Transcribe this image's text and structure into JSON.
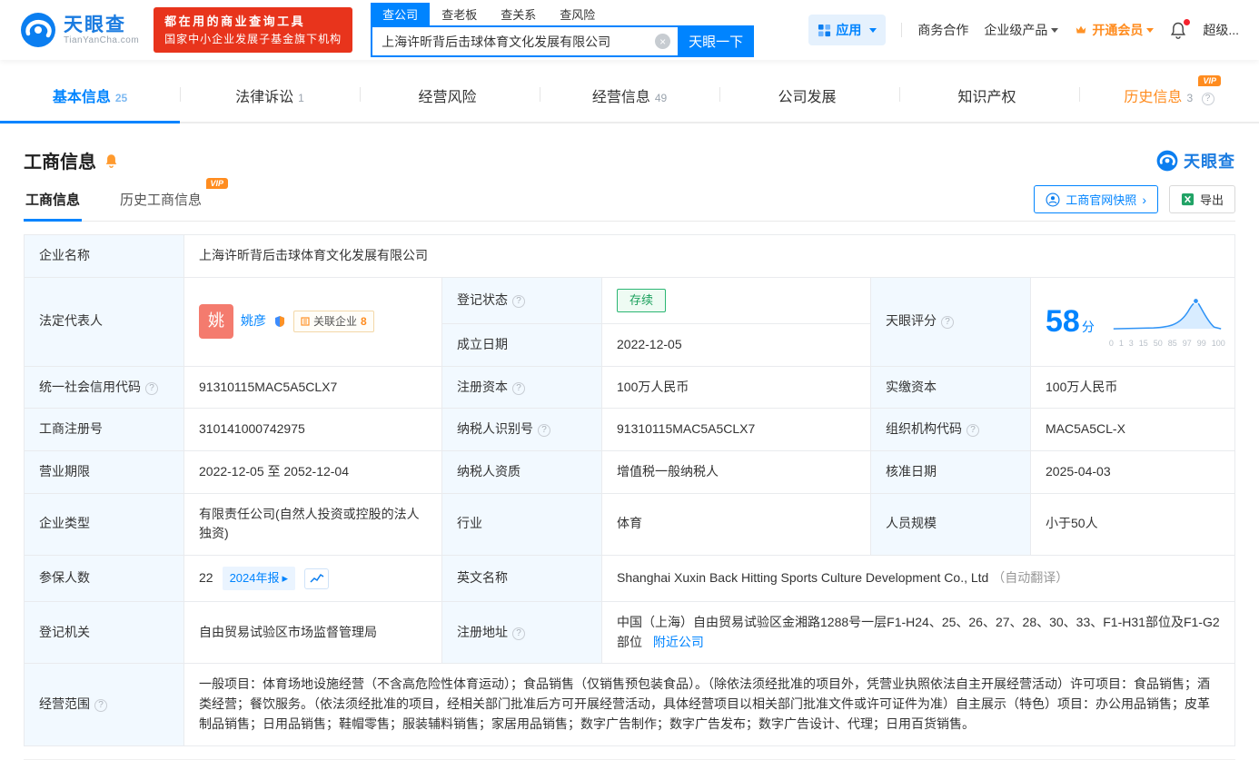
{
  "icons": {
    "close": "×",
    "question": "?",
    "chevron": "›",
    "caret_right": "▸"
  },
  "header": {
    "logo": {
      "name": "天眼查",
      "domain": "TianYanCha.com"
    },
    "promo": {
      "line1": "都在用的商业查询工具",
      "line2": "国家中小企业发展子基金旗下机构"
    },
    "search": {
      "tabs": [
        {
          "label": "查公司"
        },
        {
          "label": "查老板"
        },
        {
          "label": "查关系"
        },
        {
          "label": "查风险"
        }
      ],
      "value": "上海许昕背后击球体育文化发展有限公司",
      "submit": "天眼一下"
    },
    "nav": {
      "apps": "应用",
      "cooperation": "商务合作",
      "enterprise": "企业级产品",
      "membership": "开通会员",
      "super": "超级..."
    }
  },
  "tabs": [
    {
      "label": "基本信息",
      "count": "25"
    },
    {
      "label": "法律诉讼",
      "count": "1"
    },
    {
      "label": "经营风险",
      "count": ""
    },
    {
      "label": "经营信息",
      "count": "49"
    },
    {
      "label": "公司发展",
      "count": ""
    },
    {
      "label": "知识产权",
      "count": ""
    },
    {
      "label": "历史信息",
      "count": "3",
      "vip": "VIP"
    }
  ],
  "section": {
    "title": "工商信息",
    "brand": "天眼查",
    "subtabs": [
      {
        "label": "工商信息"
      },
      {
        "label": "历史工商信息",
        "vip": "VIP"
      }
    ],
    "snapshot": "工商官网快照",
    "export": "导出"
  },
  "fields": {
    "name": {
      "label": "企业名称",
      "value": "上海许昕背后击球体育文化发展有限公司"
    },
    "legal": {
      "label": "法定代表人",
      "avatar": "姚",
      "person": "姚彦",
      "related": "关联企业",
      "related_count": "8"
    },
    "status": {
      "label": "登记状态",
      "value": "存续"
    },
    "score": {
      "label": "天眼评分",
      "value": "58",
      "unit": "分",
      "axis": [
        "0",
        "1",
        "3",
        "15",
        "50",
        "85",
        "97",
        "99",
        "100"
      ]
    },
    "established": {
      "label": "成立日期",
      "value": "2022-12-05"
    },
    "credit_code": {
      "label": "统一社会信用代码",
      "value": "91310115MAC5A5CLX7"
    },
    "reg_capital": {
      "label": "注册资本",
      "value": "100万人民币"
    },
    "paid_capital": {
      "label": "实缴资本",
      "value": "100万人民币"
    },
    "reg_number": {
      "label": "工商注册号",
      "value": "310141000742975"
    },
    "taxpayer_id": {
      "label": "纳税人识别号",
      "value": "91310115MAC5A5CLX7"
    },
    "org_code": {
      "label": "组织机构代码",
      "value": "MAC5A5CL-X"
    },
    "term": {
      "label": "营业期限",
      "value": "2022-12-05 至 2052-12-04"
    },
    "taxpayer_quality": {
      "label": "纳税人资质",
      "value": "增值税一般纳税人"
    },
    "approval_date": {
      "label": "核准日期",
      "value": "2025-04-03"
    },
    "company_type": {
      "label": "企业类型",
      "value": "有限责任公司(自然人投资或控股的法人独资)"
    },
    "industry": {
      "label": "行业",
      "value": "体育"
    },
    "staff_size": {
      "label": "人员规模",
      "value": "小于50人"
    },
    "insured": {
      "label": "参保人数",
      "value": "22",
      "report": "2024年报"
    },
    "english_name": {
      "label": "英文名称",
      "value": "Shanghai Xuxin Back Hitting Sports Culture Development Co., Ltd",
      "note": "（自动翻译）"
    },
    "reg_authority": {
      "label": "登记机关",
      "value": "自由贸易试验区市场监督管理局"
    },
    "address": {
      "label": "注册地址",
      "value": "中国（上海）自由贸易试验区金湘路1288号一层F1-H24、25、26、27、28、30、33、F1-H31部位及F1-G2部位",
      "nearby": "附近公司"
    },
    "scope": {
      "label": "经营范围",
      "value": "一般项目：体育场地设施经营（不含高危险性体育运动）；食品销售（仅销售预包装食品）。（除依法须经批准的项目外，凭营业执照依法自主开展经营活动）许可项目：食品销售；酒类经营；餐饮服务。（依法须经批准的项目，经相关部门批准后方可开展经营活动，具体经营项目以相关部门批准文件或许可证件为准）自主展示（特色）项目：办公用品销售；皮革制品销售；日用品销售；鞋帽零售；服装辅料销售；家居用品销售；数字广告制作；数字广告发布；数字广告设计、代理；日用百货销售。"
    }
  }
}
